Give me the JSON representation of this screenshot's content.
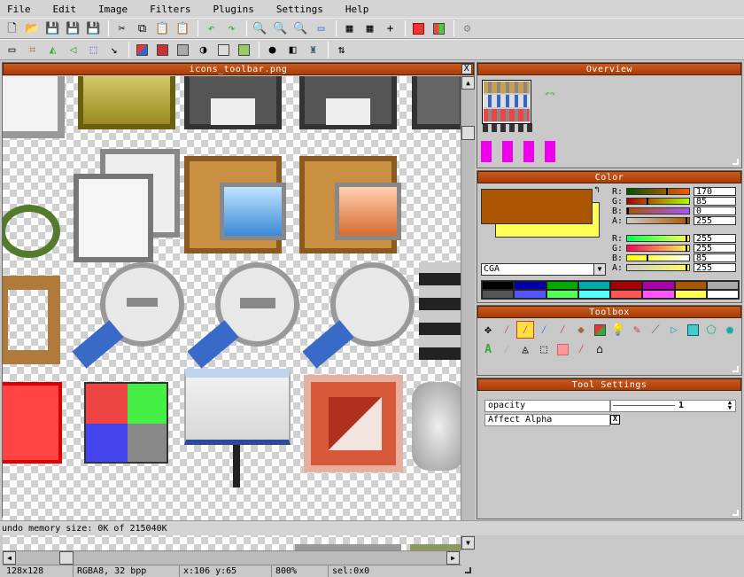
{
  "menubar": {
    "items": [
      "File",
      "Edit",
      "Image",
      "Filters",
      "Plugins",
      "Settings",
      "Help"
    ]
  },
  "toolbar1": {
    "buttons": [
      "new-file-icon",
      "open-folder-icon",
      "save-icon",
      "save-as-icon",
      "save-all-icon",
      "cut-icon",
      "copy-icon",
      "paste-icon",
      "paste-new-icon",
      "undo-icon",
      "redo-icon",
      "zoom-in-icon",
      "zoom-out-icon",
      "zoom-fit-icon",
      "presentation-icon",
      "checker-bg-icon",
      "grid-icon",
      "crosshair-icon",
      "color-red-icon",
      "color-quad-icon",
      "settings-gear-icon"
    ]
  },
  "toolbar2": {
    "buttons": [
      "select-rect-icon",
      "crop-icon",
      "flip-h-icon",
      "flip-v-icon",
      "resize-icon",
      "arrow-icon",
      "frame1-icon",
      "frame2-icon",
      "frame3-icon",
      "contrast-icon",
      "filter1-icon",
      "filter2-icon",
      "dot-icon",
      "layers-icon",
      "robot-icon",
      "swap-icon"
    ]
  },
  "image_window": {
    "title": "icons_toolbar.png",
    "close_label": "X",
    "status": {
      "size": "128x128",
      "format": "RGBA8, 32 bpp",
      "coords": "x:106 y:65",
      "zoom": "800%",
      "selection": "sel:0x0"
    }
  },
  "overview": {
    "title": "Overview"
  },
  "color": {
    "title": "Color",
    "fg_color": "#aa5500",
    "bg_color": "#ffff55",
    "swap_label": "↰",
    "fg_channels": [
      {
        "label": "R:",
        "value": "170",
        "level": 0.667
      },
      {
        "label": "G:",
        "value": "85",
        "level": 0.333
      },
      {
        "label": "B:",
        "value": "0",
        "level": 0.0
      },
      {
        "label": "A:",
        "value": "255",
        "level": 1.0
      }
    ],
    "bg_channels": [
      {
        "label": "R:",
        "value": "255",
        "level": 1.0
      },
      {
        "label": "G:",
        "value": "255",
        "level": 1.0
      },
      {
        "label": "B:",
        "value": "85",
        "level": 0.333
      },
      {
        "label": "A:",
        "value": "255",
        "level": 1.0
      }
    ],
    "palette_name": "CGA",
    "palette": [
      "#000000",
      "#0000aa",
      "#00aa00",
      "#00aaaa",
      "#aa0000",
      "#aa00aa",
      "#aa5500",
      "#aaaaaa",
      "#555555",
      "#5555ff",
      "#55ff55",
      "#55ffff",
      "#ff5555",
      "#ff55ff",
      "#ffff55",
      "#ffffff"
    ]
  },
  "toolbox": {
    "title": "Toolbox",
    "tools": [
      "move-icon",
      "picker-icon",
      "brush-selected-icon",
      "pen-icon",
      "pipette-icon",
      "eraser-icon",
      "fill-icon",
      "lightbulb-icon",
      "stamp-icon",
      "line-icon",
      "play-icon",
      "rect-icon",
      "polygon-icon",
      "circle-icon",
      "text-icon",
      "smudge-icon",
      "triangle-icon",
      "select-icon",
      "clone-icon",
      "wand-icon",
      "measure-icon"
    ]
  },
  "tool_settings": {
    "title": "Tool Settings",
    "rows": [
      {
        "name": "opacity",
        "value": "1"
      },
      {
        "name": "Affect Alpha",
        "value": "X"
      }
    ]
  },
  "footer": {
    "status": "undo memory size: 0K of 215040K"
  }
}
